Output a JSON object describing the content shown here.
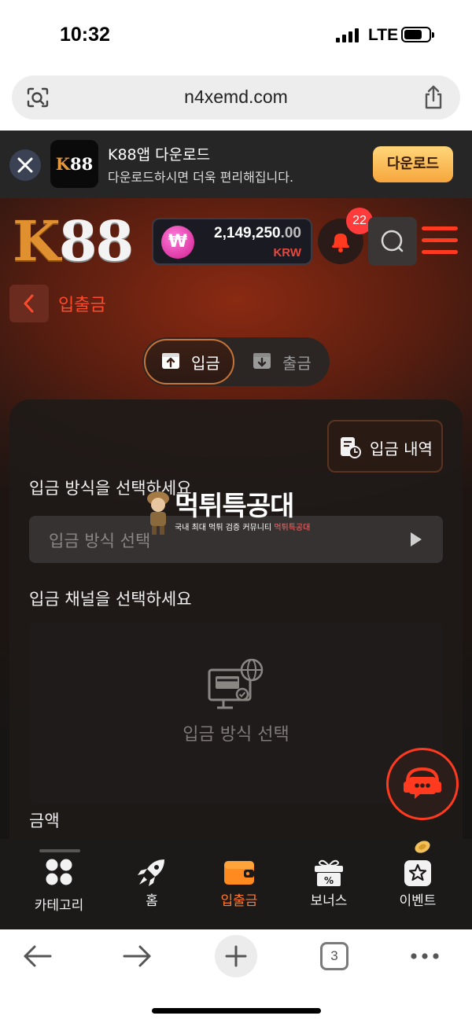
{
  "status_bar": {
    "time": "10:32",
    "network": "LTE"
  },
  "browser": {
    "url": "n4xemd.com",
    "tab_count": "3"
  },
  "app_banner": {
    "logo_text_k": "K",
    "logo_text_rest": "88",
    "title": "K88앱 다운로드",
    "subtitle": "다운로드하시면 더욱 편리해집니다.",
    "download_label": "다운로드"
  },
  "header": {
    "logo_k": "K",
    "logo_rest": "88",
    "balance_symbol": "₩",
    "balance_main": "2,149,250",
    "balance_decimal": ".00",
    "balance_currency": "KRW",
    "notification_count": "22"
  },
  "page": {
    "title": "입출금",
    "tabs": [
      {
        "label": "입금",
        "active": true
      },
      {
        "label": "출금",
        "active": false
      }
    ],
    "history_label": "입금 내역",
    "method_label": "입금 방식을 선택하세요",
    "method_placeholder": "입금 방식 선택",
    "channel_label": "입금 채널을 선택하세요",
    "channel_empty_text": "입금 방식 선택",
    "amount_label": "금액"
  },
  "watermark": {
    "title": "먹튀특공대",
    "subtitle": "국내 최대 먹튀 검증 커뮤니티",
    "subtitle_highlight": "먹튀특공대"
  },
  "bottom_nav": [
    {
      "label": "카테고리",
      "icon": "grid-icon",
      "active": false
    },
    {
      "label": "홈",
      "icon": "rocket-icon",
      "active": false
    },
    {
      "label": "입출금",
      "icon": "wallet-icon",
      "active": true
    },
    {
      "label": "보너스",
      "icon": "gift-icon",
      "active": false
    },
    {
      "label": "이벤트",
      "icon": "star-icon",
      "active": false
    }
  ],
  "colors": {
    "accent": "#ff4a2c",
    "active_nav": "#ff7a2c",
    "balance_currency": "#e8473d",
    "download_button": "#f6a63c"
  }
}
